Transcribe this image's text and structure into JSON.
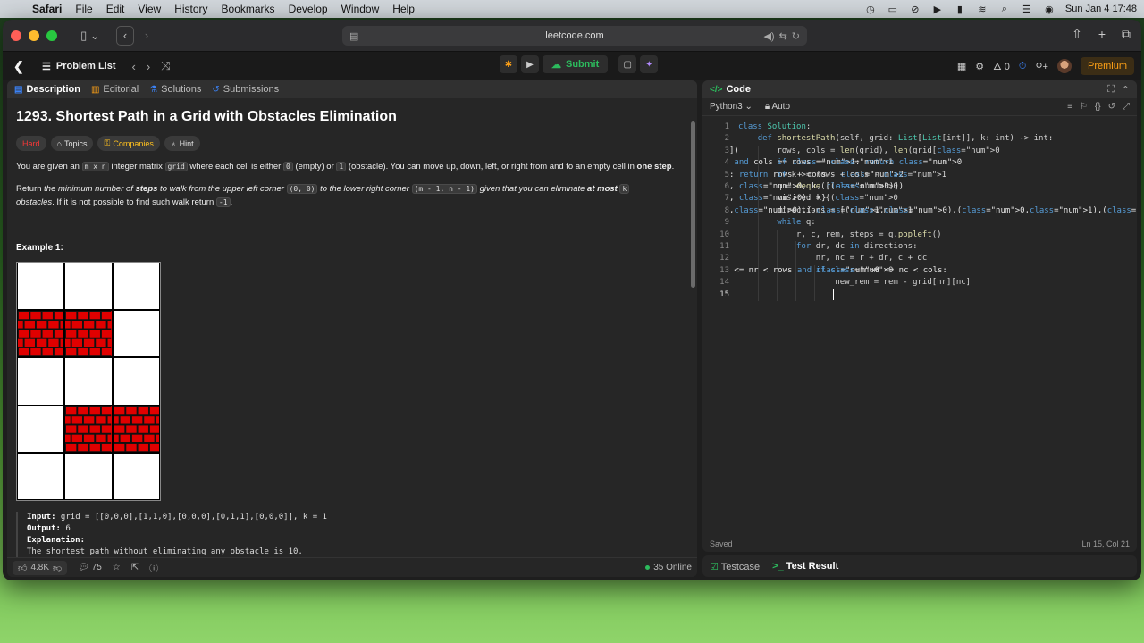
{
  "menubar": {
    "app": "Safari",
    "items": [
      "File",
      "Edit",
      "View",
      "History",
      "Bookmarks",
      "Develop",
      "Window",
      "Help"
    ],
    "datetime": "Sun Jan 4  17:48"
  },
  "browser": {
    "url": "leetcode.com"
  },
  "header": {
    "problem_list": "Problem List",
    "submit": "Submit",
    "streak": "0",
    "premium": "Premium"
  },
  "left_tabs": [
    "Description",
    "Editorial",
    "Solutions",
    "Submissions"
  ],
  "problem": {
    "title": "1293. Shortest Path in a Grid with Obstacles Elimination",
    "badges": [
      "Hard",
      "Topics",
      "Companies",
      "Hint"
    ],
    "p1": {
      "a": "You are given an ",
      "code1": "m x n",
      "b": " integer matrix ",
      "code2": "grid",
      "c": " where each cell is either ",
      "code3": "0",
      "d": " (empty) or ",
      "code4": "1",
      "e": " (obstacle). You can move up, down, left, or right from and to an empty cell in ",
      "strong": "one step",
      "f": "."
    },
    "p2": {
      "a": "Return ",
      "b": "the minimum number of ",
      "steps": "steps",
      "c": " to walk from the upper left corner ",
      "code1": "(0, 0)",
      "d": " to the lower right corner ",
      "code2": "(m - 1, n - 1)",
      "e": " given that you can eliminate ",
      "atmost": "at most",
      "code3": "k",
      "f": "obstacles",
      "g": ". If it is not possible to find such walk return ",
      "code4": "-1",
      "h": "."
    },
    "example_title": "Example 1:",
    "grid": [
      [
        0,
        0,
        0
      ],
      [
        1,
        1,
        0
      ],
      [
        0,
        0,
        0
      ],
      [
        0,
        1,
        1
      ],
      [
        0,
        0,
        0
      ]
    ],
    "example": {
      "input_label": "Input:",
      "input_value": " grid = [[0,0,0],[1,1,0],[0,0,0],[0,1,1],[0,0,0]], k = 1",
      "output_label": "Output:",
      "output_value": " 6",
      "explanation_label": "Explanation:",
      "explanation_value": "The shortest path without eliminating any obstacle is 10."
    }
  },
  "footer": {
    "likes": "4.8K",
    "comments": "75",
    "online": "35 Online"
  },
  "code_panel": {
    "title": "Code",
    "language": "Python3",
    "mode": "Auto",
    "status_saved": "Saved",
    "status_pos": "Ln 15, Col 21",
    "lines": [
      "class Solution:",
      "    def shortestPath(self, grid: List[List[int]], k: int) -> int:",
      "        rows, cols = len(grid), len(grid[0])",
      "        if rows == 1 and cols == 1: return 0",
      "        if k >= rows + cols - 1: return rows + cols - 2",
      "        q = deque([(0, 0, k, 0)])",
      "        visited = {(0, 0): k}",
      "        directions = [(1,0),(-1,0),(0,1),(0,-1)]",
      "        while q:",
      "            r, c, rem, steps = q.popleft()",
      "            for dr, dc in directions:",
      "                nr, nc = r + dr, c + dc",
      "                if 0 <= nr < rows and 0 <= nc < cols:",
      "                    new_rem = rem - grid[nr][nc]",
      "                    "
    ]
  },
  "bottom_tabs": [
    "Testcase",
    "Test Result"
  ]
}
